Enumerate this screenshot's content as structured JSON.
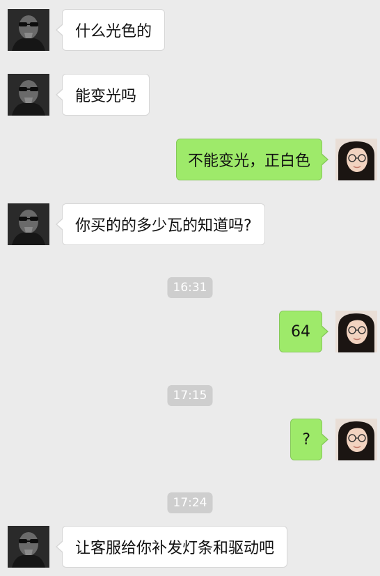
{
  "chat": {
    "messages": [
      {
        "side": "left",
        "text": "什么光色的"
      },
      {
        "side": "left",
        "text": "能变光吗"
      },
      {
        "side": "right",
        "text": "不能变光，正白色"
      },
      {
        "side": "left",
        "text": "你买的的多少瓦的知道吗?"
      },
      {
        "side": "right",
        "text": "64"
      },
      {
        "side": "right",
        "text": "?"
      },
      {
        "side": "left",
        "text": "让客服给你补发灯条和驱动吧"
      }
    ],
    "timestamps": [
      "16:31",
      "17:15",
      "17:24"
    ]
  },
  "colors": {
    "background": "#ebebeb",
    "incoming_bubble": "#ffffff",
    "outgoing_bubble": "#9eea6a",
    "timestamp_bg": "#cecece"
  },
  "icons": {
    "left_avatar": "man-sunglasses-avatar",
    "right_avatar": "woman-glasses-avatar"
  }
}
